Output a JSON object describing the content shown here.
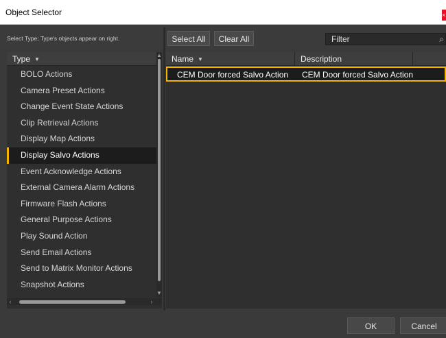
{
  "window": {
    "title": "Object Selector",
    "close_glyph": "×"
  },
  "left": {
    "hint": "Select Type; Type's objects appear on right.",
    "column_header": "Type",
    "items": [
      "BOLO Actions",
      "Camera Preset Actions",
      "Change Event State Actions",
      "Clip Retrieval Actions",
      "Display Map Actions",
      "Display Salvo Actions",
      "Event Acknowledge Actions",
      "External Camera Alarm Actions",
      "Firmware Flash Actions",
      "General Purpose Actions",
      "Play Sound Action",
      "Send Email Actions",
      "Send to Matrix Monitor Actions",
      "Snapshot Actions"
    ],
    "selected_item": "Display Salvo Actions"
  },
  "toolbar": {
    "select_all": "Select All",
    "clear_all": "Clear All",
    "filter_placeholder": "Filter",
    "search_glyph": "⌕"
  },
  "table": {
    "columns": [
      "Name",
      "Description"
    ],
    "rows": [
      {
        "name": "CEM Door forced Salvo Action",
        "description": "CEM Door forced Salvo Action"
      }
    ]
  },
  "footer": {
    "ok": "OK",
    "cancel": "Cancel"
  },
  "colors": {
    "accent": "#f5b400",
    "close": "#e81123",
    "background": "#3a3a3a"
  },
  "icons": {
    "sort": "chevron-down-icon",
    "search": "search-icon",
    "close": "close-icon"
  }
}
